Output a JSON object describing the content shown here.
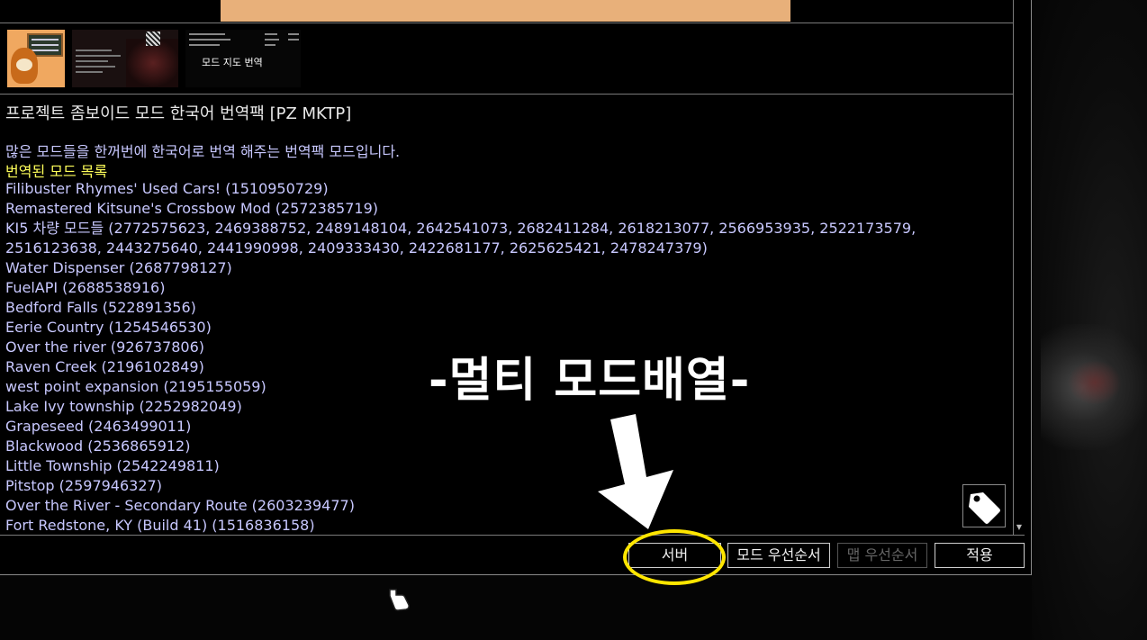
{
  "mod": {
    "title": "프로젝트 좀보이드 모드 한국어 번역팩 [PZ MKTP]",
    "description": "많은 모드들을 한꺼번에 한국어로 번역 해주는 번역팩 모드입니다.",
    "list_heading": "번역된 모드 목록",
    "translated_mods": [
      "Filibuster Rhymes' Used Cars! (1510950729)",
      "Remastered Kitsune's Crossbow Mod (2572385719)",
      "KI5 차량 모드들 (2772575623, 2469388752, 2489148104, 2642541073, 2682411284, 2618213077, 2566953935, 2522173579,",
      "2516123638, 2443275640, 2441990998, 2409333430, 2422681177, 2625625421, 2478247379)",
      "Water Dispenser (2687798127)",
      "FuelAPI (2688538916)",
      "Bedford Falls (522891356)",
      "Eerie Country (1254546530)",
      "Over the river (926737806)",
      "Raven Creek (2196102849)",
      "west point expansion (2195155059)",
      "Lake Ivy township (2252982049)",
      "Grapeseed (2463499011)",
      "Blackwood (2536865912)",
      "Little Township (2542249811)",
      "Pitstop (2597946327)",
      "Over the River - Secondary Route (2603239477)",
      "Fort Redstone, KY (Build 41) (1516836158)"
    ]
  },
  "thumbnails": {
    "thumb3_caption": "모드 지도 번역"
  },
  "buttons": {
    "server": "서버",
    "mod_order": "모드 우선순서",
    "map_order": "맵 우선순서",
    "apply": "적용"
  },
  "annotation": {
    "text": "-멀티 모드배열-"
  },
  "icons": {
    "tag": "tag-icon",
    "scroll_down": "scroll-down-arrow-icon",
    "cursor": "hand-pointer-icon",
    "arrow": "down-arrow-icon"
  },
  "colors": {
    "description": "#c8c8ff",
    "heading": "#ffff5a",
    "highlight": "#ffe600",
    "poster": "#e8b07a"
  }
}
